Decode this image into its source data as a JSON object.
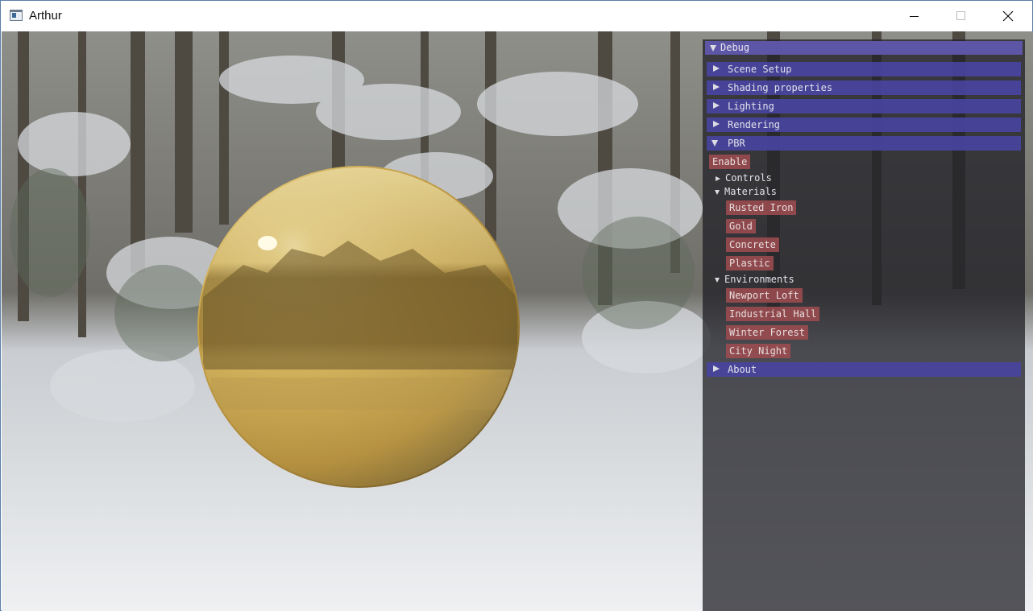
{
  "window": {
    "title": "Arthur",
    "controls": {
      "minimize": "minimize-icon",
      "maximize": "maximize-icon",
      "close": "close-icon"
    }
  },
  "debug_panel": {
    "title": "Debug",
    "sections": [
      {
        "label": "Scene Setup",
        "expanded": false
      },
      {
        "label": "Shading properties",
        "expanded": false
      },
      {
        "label": "Lighting",
        "expanded": false
      },
      {
        "label": "Rendering",
        "expanded": false
      },
      {
        "label": "PBR",
        "expanded": true
      }
    ],
    "pbr": {
      "enable_label": "Enable",
      "controls_label": "Controls",
      "materials_label": "Materials",
      "materials": [
        "Rusted Iron",
        "Gold",
        "Concrete",
        "Plastic"
      ],
      "environments_label": "Environments",
      "environments": [
        "Newport Loft",
        "Industrial Hall",
        "Winter Forest",
        "City Night"
      ]
    },
    "about_label": "About"
  },
  "colors": {
    "header": "#4844a0",
    "button": "#9c4c50",
    "panel_bg": "#1e1e24",
    "sphere": "#c9a44a"
  }
}
